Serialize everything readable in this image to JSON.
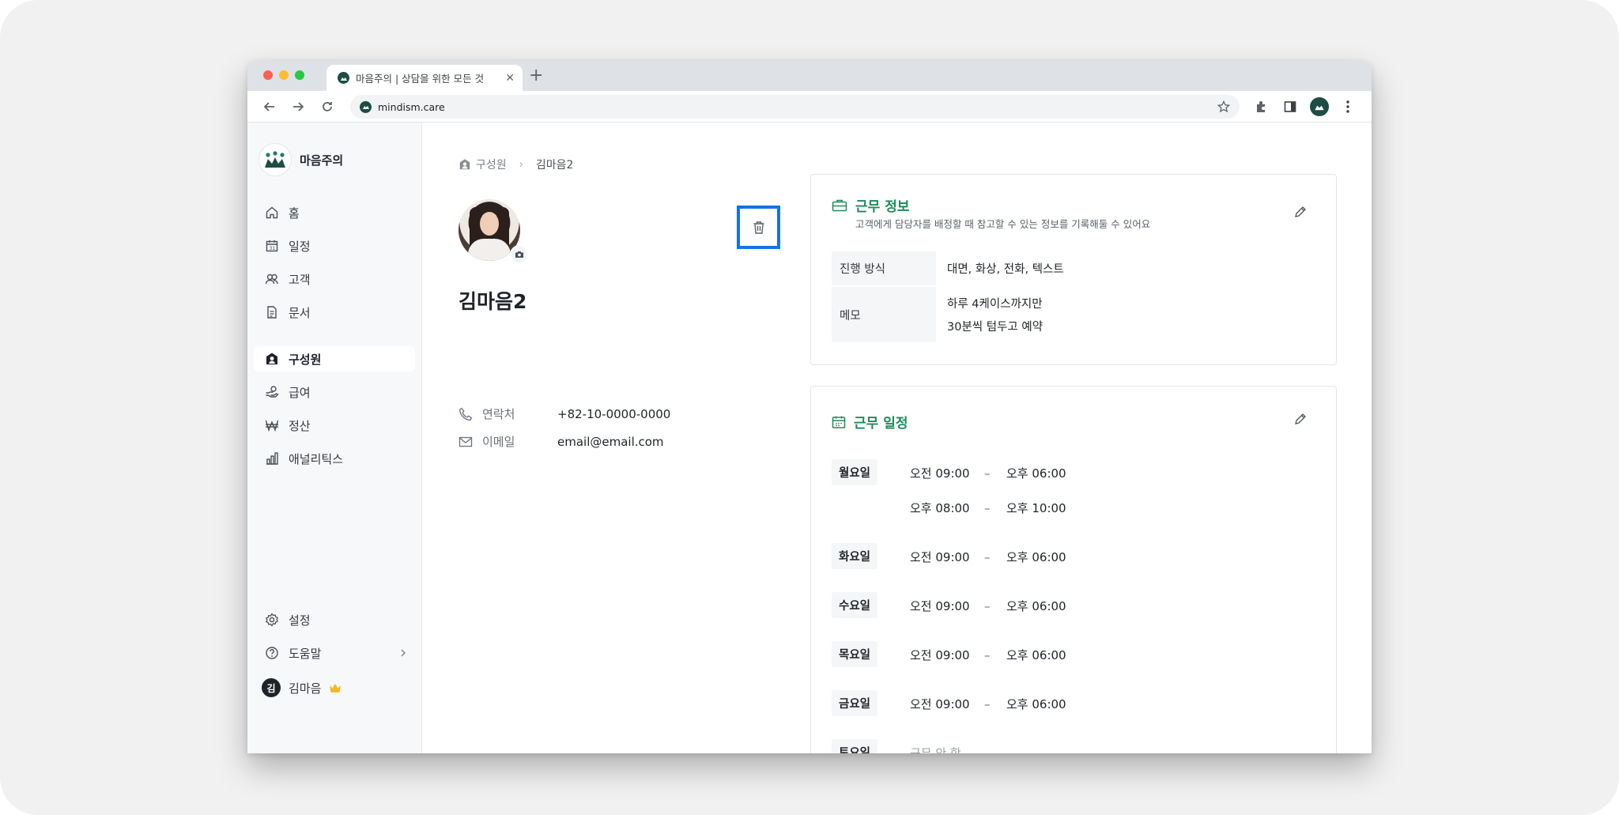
{
  "browser": {
    "tab_title": "마음주의 | 상담을 위한 모든 것",
    "url": "mindism.care"
  },
  "brand": {
    "name": "마음주의"
  },
  "sidebar": {
    "items": [
      {
        "label": "홈",
        "icon": "home-icon"
      },
      {
        "label": "일정",
        "icon": "calendar-icon"
      },
      {
        "label": "고객",
        "icon": "people-icon"
      },
      {
        "label": "문서",
        "icon": "document-icon"
      },
      {
        "label": "구성원",
        "icon": "member-icon",
        "active": true
      },
      {
        "label": "급여",
        "icon": "payroll-icon"
      },
      {
        "label": "정산",
        "icon": "won-icon"
      },
      {
        "label": "애널리틱스",
        "icon": "analytics-icon"
      }
    ],
    "settings_label": "설정",
    "help_label": "도움말",
    "user_initial": "김",
    "user_name": "김마음"
  },
  "breadcrumb": {
    "parent": "구성원",
    "current": "김마음2"
  },
  "member": {
    "name": "김마음2",
    "phone_label": "연락처",
    "phone": "+82-10-0000-0000",
    "email_label": "이메일",
    "email": "email@email.com"
  },
  "work_info": {
    "title": "근무 정보",
    "subtitle": "고객에게 담당자를 배정할 때 참고할 수 있는 정보를 기록해둘 수 있어요",
    "rows": [
      {
        "key": "진행 방식",
        "lines": [
          "대면, 화상, 전화, 텍스트"
        ]
      },
      {
        "key": "메모",
        "lines": [
          "하루 4케이스까지만",
          "30분씩 텀두고 예약"
        ]
      }
    ]
  },
  "work_schedule": {
    "title": "근무 일정",
    "dash": "–",
    "days": [
      {
        "day": "월요일",
        "slots": [
          [
            "오전 09:00",
            "오후 06:00"
          ],
          [
            "오후 08:00",
            "오후 10:00"
          ]
        ]
      },
      {
        "day": "화요일",
        "slots": [
          [
            "오전 09:00",
            "오후 06:00"
          ]
        ]
      },
      {
        "day": "수요일",
        "slots": [
          [
            "오전 09:00",
            "오후 06:00"
          ]
        ]
      },
      {
        "day": "목요일",
        "slots": [
          [
            "오전 09:00",
            "오후 06:00"
          ]
        ]
      },
      {
        "day": "금요일",
        "slots": [
          [
            "오전 09:00",
            "오후 06:00"
          ]
        ]
      },
      {
        "day": "토요일",
        "off": "근무 안 함"
      }
    ]
  }
}
